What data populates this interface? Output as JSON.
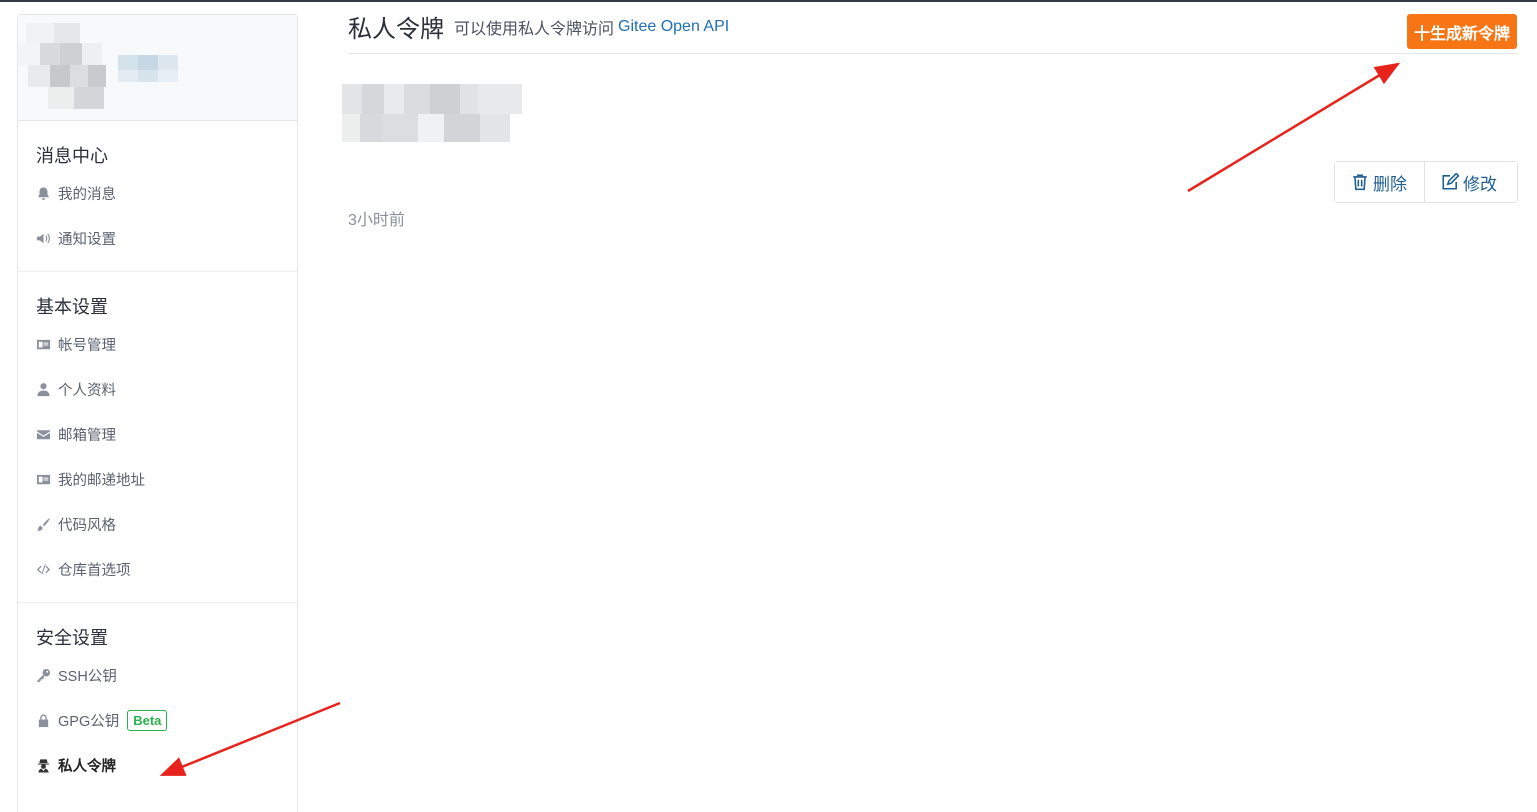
{
  "colors": {
    "accent": "#f87515",
    "link": "#1f6fb5",
    "beta": "#2bb24c",
    "annotation": "#e8231c"
  },
  "sidebar": {
    "sections": [
      {
        "title": "消息中心",
        "items": [
          {
            "label": "我的消息",
            "icon": "bell-icon"
          },
          {
            "label": "通知设置",
            "icon": "volume-icon"
          }
        ]
      },
      {
        "title": "基本设置",
        "items": [
          {
            "label": "帐号管理",
            "icon": "id-card-icon"
          },
          {
            "label": "个人资料",
            "icon": "user-icon"
          },
          {
            "label": "邮箱管理",
            "icon": "envelope-icon"
          },
          {
            "label": "我的邮递地址",
            "icon": "address-card-icon"
          },
          {
            "label": "代码风格",
            "icon": "brush-icon"
          },
          {
            "label": "仓库首选项",
            "icon": "code-icon"
          }
        ]
      },
      {
        "title": "安全设置",
        "items": [
          {
            "label": "SSH公钥",
            "icon": "key-icon"
          },
          {
            "label": "GPG公钥",
            "icon": "lock-icon",
            "badge": "Beta"
          },
          {
            "label": "私人令牌",
            "icon": "user-secret-icon",
            "active": true
          }
        ]
      }
    ]
  },
  "header": {
    "title": "私人令牌",
    "subtitle": "可以使用私人令牌访问",
    "link_text": "Gitee Open API",
    "generate_button": "十生成新令牌"
  },
  "token": {
    "time": "3小时前",
    "delete_label": "删除",
    "edit_label": "修改"
  }
}
